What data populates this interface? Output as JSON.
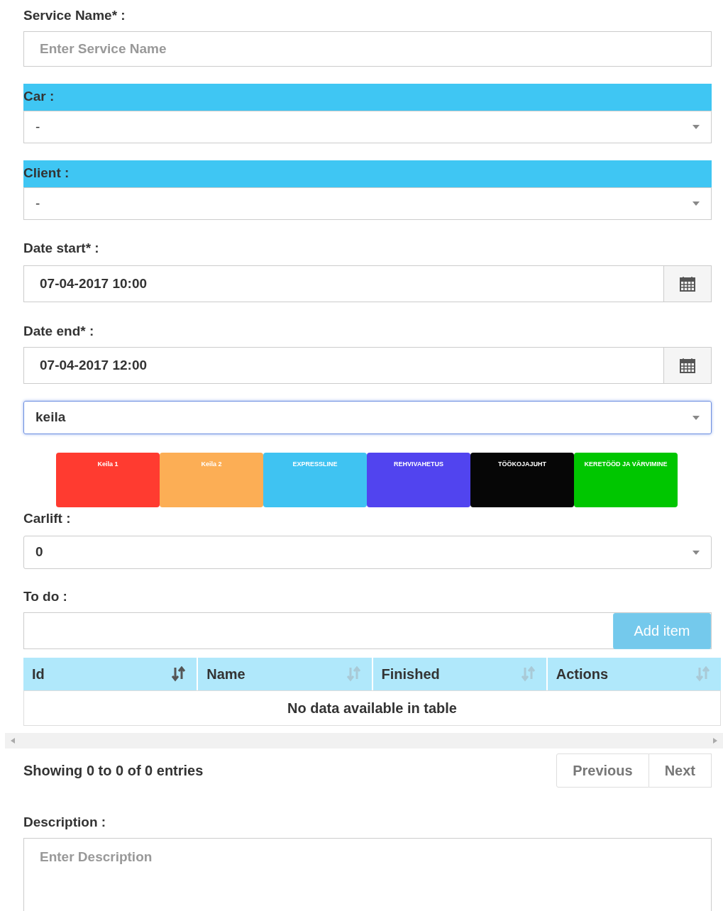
{
  "service_name": {
    "label": "Service Name* :",
    "placeholder": "Enter Service Name"
  },
  "car": {
    "label": "Car :",
    "value": "-"
  },
  "client": {
    "label": "Client :",
    "value": "-"
  },
  "date_start": {
    "label": "Date start* :",
    "value": "07-04-2017 10:00"
  },
  "date_end": {
    "label": "Date end* :",
    "value": "07-04-2017 12:00"
  },
  "location": {
    "value": "keila",
    "focused": true
  },
  "lifts": [
    {
      "label": "Keila 1",
      "color": "#ff3b30"
    },
    {
      "label": "Keila 2",
      "color": "#fcae55"
    },
    {
      "label": "EXPRESSLINE",
      "color": "#3fc3f2"
    },
    {
      "label": "REHVIVAHETUS",
      "color": "#5144ef"
    },
    {
      "label": "TÖÖKOJAJUHT",
      "color": "#060606"
    },
    {
      "label": "KERETÖÖD JA VÄRVIMINE",
      "color": "#00c600"
    }
  ],
  "carlift": {
    "label": "Carlift :",
    "value": "0"
  },
  "todo": {
    "label": "To do :",
    "button": "Add item",
    "button_disabled": true
  },
  "table": {
    "columns": [
      {
        "label": "Id",
        "sorted": true
      },
      {
        "label": "Name",
        "sorted": false
      },
      {
        "label": "Finished",
        "sorted": false
      },
      {
        "label": "Actions",
        "sorted": false
      }
    ],
    "empty": "No data available in table"
  },
  "info": "Showing 0 to 0 of 0 entries",
  "pagination": [
    "Previous",
    "Next"
  ],
  "description": {
    "label": "Description :",
    "placeholder": "Enter Description"
  }
}
